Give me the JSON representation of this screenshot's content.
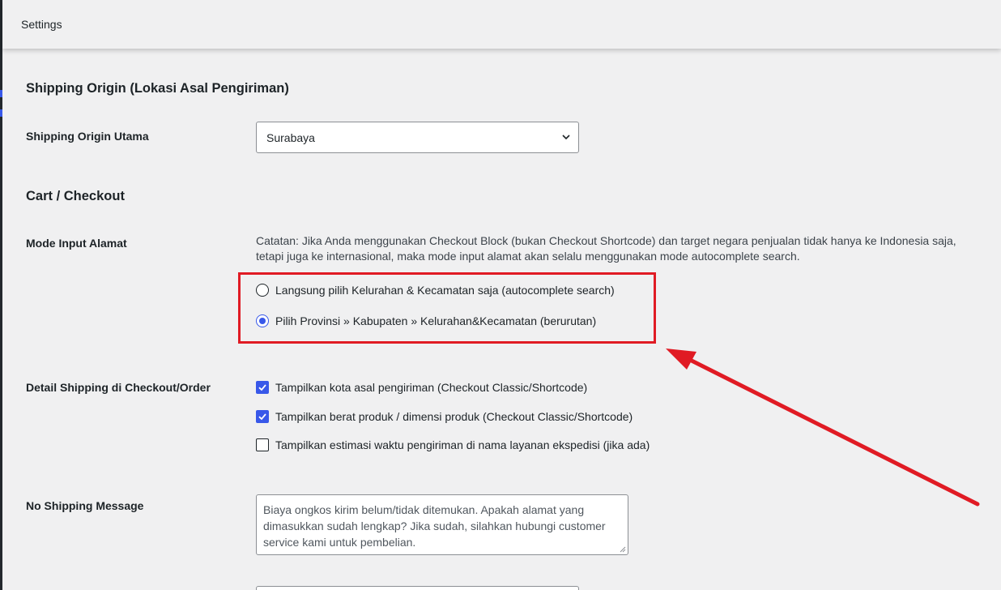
{
  "topbar": {
    "title": "Settings"
  },
  "shipping_origin": {
    "section_title": "Shipping Origin (Lokasi Asal Pengiriman)",
    "label": "Shipping Origin Utama",
    "selected": "Surabaya"
  },
  "cart_checkout": {
    "section_title": "Cart / Checkout",
    "mode_label": "Mode Input Alamat",
    "note": "Catatan: Jika Anda menggunakan Checkout Block (bukan Checkout Shortcode) dan target negara penjualan tidak hanya ke Indonesia saja, tetapi juga ke internasional, maka mode input alamat akan selalu menggunakan mode autocomplete search.",
    "radio_options": [
      {
        "label": "Langsung pilih Kelurahan & Kecamatan saja (autocomplete search)",
        "checked": false
      },
      {
        "label": "Pilih Provinsi » Kabupaten » Kelurahan&Kecamatan (berurutan)",
        "checked": true
      }
    ],
    "detail_label": "Detail Shipping di Checkout/Order",
    "checkboxes": [
      {
        "label": "Tampilkan kota asal pengiriman (Checkout Classic/Shortcode)",
        "checked": true
      },
      {
        "label": "Tampilkan berat produk / dimensi produk (Checkout Classic/Shortcode)",
        "checked": true
      },
      {
        "label": "Tampilkan estimasi waktu pengiriman di nama layanan ekspedisi (jika ada)",
        "checked": false
      }
    ],
    "no_shipping_label": "No Shipping Message",
    "no_shipping_message": "Biaya ongkos kirim belum/tidak ditemukan. Apakah alamat yang dimasukkan sudah lengkap? Jika sudah, silahkan hubungi customer service kami untuk pembelian."
  },
  "colors": {
    "accent": "#3858e9",
    "annotation": "#e01b24",
    "background": "#f0f0f1"
  }
}
